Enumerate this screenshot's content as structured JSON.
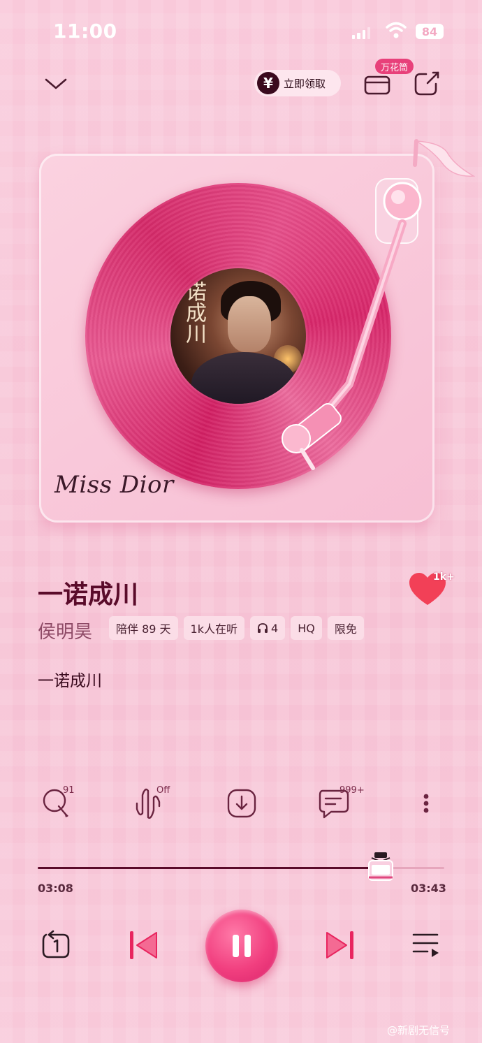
{
  "status_bar": {
    "time": "11:00",
    "battery": "84"
  },
  "top_bar": {
    "promo_label": "立即领取",
    "promo_icon": "yen-icon",
    "kaleidoscope_badge": "万花筒"
  },
  "cover": {
    "brand_text": "Miss Dior",
    "album_title": "诺成川"
  },
  "song": {
    "title": "一诺成川",
    "artist": "侯明昊",
    "like_count": "1k+",
    "tags": [
      "陪伴 89 天",
      "1k人在听",
      "4",
      "HQ",
      "限免"
    ]
  },
  "lyric": "一诺成川",
  "actions": {
    "search_count": "91",
    "effect_state": "Off",
    "comment_count": "999+"
  },
  "progress": {
    "current": "03:08",
    "total": "03:43",
    "fraction": 0.843
  },
  "watermark": "@新剧无信号",
  "colors": {
    "accent": "#f13f7f",
    "dark": "#5a0b2a",
    "background": "#f8c6d8"
  }
}
